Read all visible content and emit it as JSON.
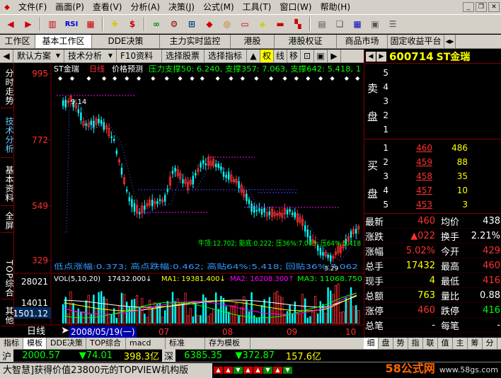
{
  "menu": {
    "items": [
      "文件(F)",
      "画面(P)",
      "查看(V)",
      "分析(A)",
      "决策(J)",
      "公式(M)",
      "工具(T)",
      "窗口(W)",
      "帮助(H)"
    ]
  },
  "toolbar": {
    "icons": [
      "back-icon",
      "forward-icon",
      "kline-icon",
      "rsi-icon",
      "chart-icon",
      "crosshair-icon",
      "dollar-icon",
      "glasses-icon",
      "gear-icon",
      "binoculars-icon",
      "diamond-icon",
      "ring-icon",
      "card-icon",
      "yellow-diamond-icon",
      "bar-icon",
      "win-icon",
      "doc-icon",
      "copy-icon",
      "grid-icon",
      "info-icon",
      "settings-icon"
    ],
    "rsi_label": "RSI"
  },
  "tabbar": {
    "label": "工作区",
    "tabs": [
      "基本工作区",
      "DDE决策",
      "主力实时监控",
      "港股",
      "港股权证",
      "商品市场",
      "固定收益平台"
    ]
  },
  "subbar": {
    "scheme": "默认方案",
    "analysis": "技术分析",
    "f10": "F10资料",
    "select_stock": "选择股票",
    "select_index": "选择指标",
    "quan": "权",
    "line": "线",
    "move": "移"
  },
  "leftstrip": {
    "tabs": [
      "分时走势",
      "技术分析",
      "基本资料",
      "全屏",
      "TOP综合",
      "其他"
    ]
  },
  "chart": {
    "stock_label": "ST金瑞",
    "period": "日线",
    "predict": "价格预测",
    "support": "压力支撑50: 6.240, 支撑357: 7.063, 支撑642: 5.418, 1",
    "high_mark": "9.14",
    "y_ticks": [
      "995",
      "772",
      "549",
      "329"
    ],
    "vol_ticks": [
      "28021",
      "14011",
      "1501.12"
    ],
    "bottom_line": "牛顶:12.702; 能底:0.222; 压36%:7.063; 压64%:5.418",
    "bottom_line2": "低点涨幅:0.373; 高点跌幅:0.462; 高贴64%:5.418; 回贴36%:7.062",
    "mark_low": "3.29",
    "vol_legend": {
      "vol": "VOL(5,10,20)",
      "v1": "17432.000↓",
      "ma1": "MA1: 19381.400↓",
      "ma2": "MA2: 16208.300↑",
      "ma3": "MA3: 11068.750"
    },
    "date_cursor": "2008/05/19(一)",
    "period_label": "日线",
    "months": [
      "07",
      "08",
      "09",
      "10"
    ]
  },
  "bottomtabs": [
    "指标",
    "模板",
    "DDE决策",
    "TOP综合",
    "macd",
    "标准",
    "存为模板"
  ],
  "quote": {
    "code": "600714",
    "name": "ST金瑞",
    "sell_label_1": "卖",
    "sell_label_2": "盘",
    "buy_label_1": "买",
    "buy_label_2": "盘",
    "sells": [
      {
        "lvl": "5",
        "price": "",
        "vol": ""
      },
      {
        "lvl": "4",
        "price": "",
        "vol": ""
      },
      {
        "lvl": "3",
        "price": "",
        "vol": ""
      },
      {
        "lvl": "2",
        "price": "",
        "vol": ""
      },
      {
        "lvl": "1",
        "price": "",
        "vol": ""
      }
    ],
    "buys": [
      {
        "lvl": "1",
        "price": "460",
        "vol": "486"
      },
      {
        "lvl": "2",
        "price": "459",
        "vol": "88"
      },
      {
        "lvl": "3",
        "price": "458",
        "vol": "35"
      },
      {
        "lvl": "4",
        "price": "457",
        "vol": "10"
      },
      {
        "lvl": "5",
        "price": "453",
        "vol": "3"
      }
    ],
    "stats": [
      {
        "k1": "最新",
        "v1": "460",
        "c1": "red",
        "k2": "均价",
        "v2": "438",
        "c2": "wht"
      },
      {
        "k1": "涨跌",
        "v1": "▲022",
        "c1": "red",
        "k2": "换手",
        "v2": "2.21%",
        "c2": "wht"
      },
      {
        "k1": "涨幅",
        "v1": "5.02%",
        "c1": "red",
        "k2": "今开",
        "v2": "429",
        "c2": "red"
      },
      {
        "k1": "总手",
        "v1": "17432",
        "c1": "yel",
        "k2": "最高",
        "v2": "460",
        "c2": "red"
      },
      {
        "k1": "现手",
        "v1": "4",
        "c1": "yel",
        "k2": "最低",
        "v2": "416",
        "c2": "red"
      },
      {
        "k1": "总额",
        "v1": "763",
        "c1": "yel",
        "k2": "量比",
        "v2": "0.88",
        "c2": "wht"
      },
      {
        "k1": "涨停",
        "v1": "460",
        "c1": "red",
        "k2": "跌停",
        "v2": "416",
        "c2": "grn"
      },
      {
        "k1": "总笔",
        "v1": "-",
        "c1": "wht",
        "k2": "每笔",
        "v2": "-",
        "c2": "wht"
      }
    ]
  },
  "qtabs": [
    "细",
    "盘",
    "势",
    "指",
    "联",
    "值",
    "主",
    "筹",
    "分"
  ],
  "ticker": {
    "sh_label": "沪",
    "sh_index": "2000.57",
    "sh_change": "▼74.01",
    "sh_amount": "398.3亿",
    "sz_label": "深",
    "sz_index": "6385.35",
    "sz_change": "▼372.87",
    "sz_amount": "157.6亿"
  },
  "news": {
    "text": "大智慧]获得价值23800元的TOPVIEW机构版"
  },
  "watermark": {
    "brand": "58公式网",
    "url": "www.58gs.com"
  },
  "colors": {
    "up": "#ff3030",
    "down": "#00ffff",
    "ma_white": "#ffffff",
    "ma_yellow": "#ffff00",
    "ma_magenta": "#ff00ff",
    "ma_green": "#00ff00",
    "frame": "#800000"
  }
}
